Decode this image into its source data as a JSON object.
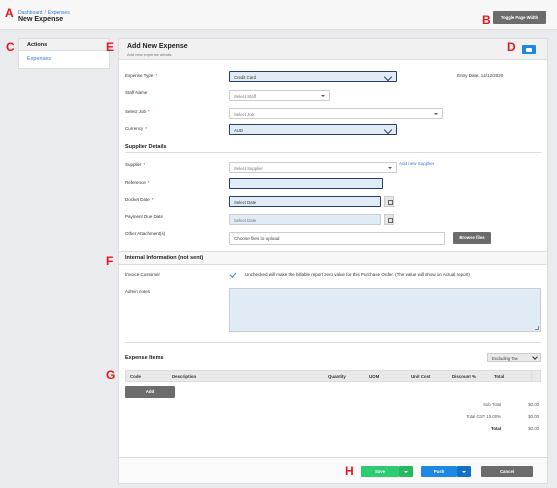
{
  "markers": {
    "a": "A",
    "b": "B",
    "c": "C",
    "d": "D",
    "e": "E",
    "f": "F",
    "g": "G",
    "h": "H"
  },
  "header": {
    "breadcrumb": [
      "Dashboard",
      "Expenses"
    ],
    "breadcrumb_sep": "/",
    "title": "New Expense",
    "toggle_label": "Toggle Page Width"
  },
  "sidebar": {
    "heading": "Actions",
    "items": [
      {
        "label": "Expenses"
      }
    ]
  },
  "panel": {
    "title": "Add New Expense",
    "subtitle": "Add new expense details",
    "print_icon": "printer-icon",
    "entry_date": "Entry Date: 14/12/2020"
  },
  "form": {
    "expense_type": {
      "label": "Expense Type",
      "value": "Credit Card"
    },
    "staff_name": {
      "label": "Staff Name",
      "placeholder": "Select Staff"
    },
    "select_job": {
      "label": "Select Job",
      "placeholder": "Select Job"
    },
    "currency": {
      "label": "Currency",
      "value": "AUD"
    },
    "required_mark": "*"
  },
  "supplier": {
    "heading": "Supplier Details",
    "supplier": {
      "label": "Supplier",
      "placeholder": "Select Supplier"
    },
    "add_new_link": "Add new Supplier",
    "reference": {
      "label": "Reference",
      "value": ""
    },
    "docket_date": {
      "label": "Docket Date",
      "placeholder": "Select Date"
    },
    "payment_due": {
      "label": "Payment Due Date",
      "placeholder": "Select Date"
    },
    "attachments": {
      "label": "Other Attachment(s)",
      "placeholder": "Choose files to upload",
      "browse": "Browse files"
    }
  },
  "internal": {
    "heading": "Internal Information (not sent)",
    "invoice_label": "Invoice Customer",
    "invoice_checked": true,
    "invoice_note": "Unchecked will make the billable report zero value for this Purchase Order. (The value will show on Actual report)",
    "admin_label": "Admin notes"
  },
  "items": {
    "heading": "Expense Items",
    "tax_mode": "Excluding Tax",
    "columns": [
      "Code",
      "Description",
      "Quantity",
      "UOM",
      "Unit Cost",
      "Discount %",
      "Total"
    ],
    "add_label": "Add",
    "totals": [
      {
        "label": "Sub Total",
        "value": "$0.00"
      },
      {
        "label": "Total GST 10.00%",
        "value": "$0.00"
      },
      {
        "label": "Total",
        "value": "$0.00"
      }
    ]
  },
  "footer": {
    "save": "Save",
    "push": "Push",
    "cancel": "Cancel"
  },
  "colors": {
    "save": "#2ecc71",
    "push": "#1e88e5",
    "cancel": "#6c6c6c",
    "marker": "#e8141d"
  }
}
